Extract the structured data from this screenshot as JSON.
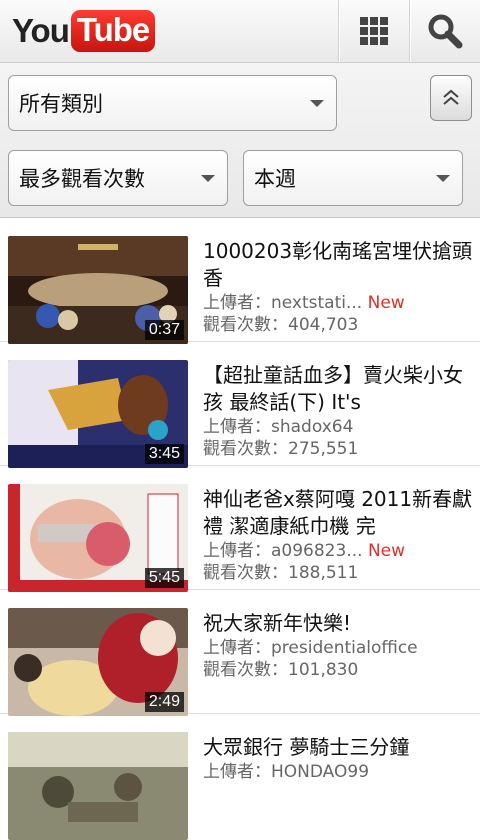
{
  "header": {
    "logo_you": "You",
    "logo_tube": "Tube",
    "grid_icon": "grid-icon",
    "search_icon": "search-icon"
  },
  "filters": {
    "category": "所有類別",
    "sort": "最多觀看次數",
    "time": "本週",
    "collapse_icon": "chevron-up-icon"
  },
  "videos": [
    {
      "title": "1000203彰化南瑤宮埋伏搶頭香",
      "uploader_label": "上傳者：",
      "uploader": "nextstati...",
      "badge": "New",
      "views_label": "觀看次數：",
      "views": "404,703",
      "duration": "0:37"
    },
    {
      "title": "【超扯童話血多】賣火柴小女孩 最終話(下) It's",
      "uploader_label": "上傳者：",
      "uploader": "shadox64",
      "badge": "",
      "views_label": "觀看次數：",
      "views": "275,551",
      "duration": "3:45"
    },
    {
      "title": "神仙老爸x蔡阿嘎 2011新春獻禮 潔適康紙巾機 完",
      "uploader_label": "上傳者：",
      "uploader": "a096823...",
      "badge": "New",
      "views_label": "觀看次數：",
      "views": "188,511",
      "duration": "5:45"
    },
    {
      "title": "祝大家新年快樂!",
      "uploader_label": "上傳者：",
      "uploader": "presidentialoffice",
      "badge": "",
      "views_label": "觀看次數：",
      "views": "101,830",
      "duration": "2:49"
    },
    {
      "title": "大眾銀行 夢騎士三分鐘",
      "uploader_label": "上傳者：",
      "uploader": "HONDAO99",
      "badge": "",
      "views_label": "",
      "views": "",
      "duration": ""
    }
  ]
}
